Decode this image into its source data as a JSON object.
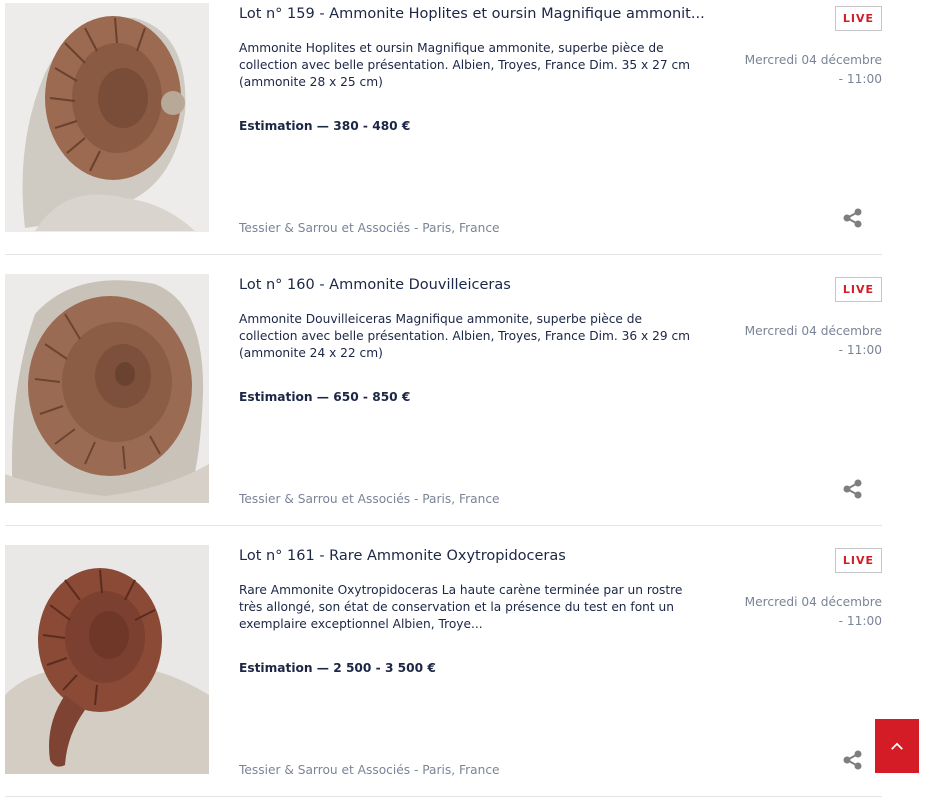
{
  "colors": {
    "accent": "#d41c26",
    "text": "#1c2645",
    "muted": "#7b8497"
  },
  "lots": [
    {
      "title": "Lot n° 159 - Ammonite Hoplites et oursin Magnifique ammonit...",
      "description": "Ammonite Hoplites et oursin Magnifique ammonite, superbe pièce de collection avec belle présentation. Albien, Troyes, France Dim. 35 x 27 cm (ammonite 28 x 25 cm)",
      "estimate": "Estimation — 380 - 480 €",
      "house": "Tessier & Sarrou et Associés - Paris, France",
      "badge": "LIVE",
      "date_line1": "Mercredi 04 décembre",
      "date_line2": "- 11:00",
      "image_icon": "ammonite-photo"
    },
    {
      "title": "Lot n° 160 - Ammonite Douvilleiceras",
      "description": "Ammonite Douvilleiceras Magnifique ammonite, superbe pièce de collection avec belle présentation. Albien, Troyes, France Dim. 36 x 29 cm (ammonite 24 x 22 cm)",
      "estimate": "Estimation — 650 - 850 €",
      "house": "Tessier & Sarrou et Associés - Paris, France",
      "badge": "LIVE",
      "date_line1": "Mercredi 04 décembre",
      "date_line2": "- 11:00",
      "image_icon": "ammonite-photo"
    },
    {
      "title": "Lot n° 161 - Rare Ammonite Oxytropidoceras",
      "description": "Rare Ammonite Oxytropidoceras La haute carène terminée par un rostre très allongé, son état de conservation et la présence du test en font un exemplaire exceptionnel Albien, Troye...",
      "estimate": "Estimation — 2 500 - 3 500 €",
      "house": "Tessier & Sarrou et Associés - Paris, France",
      "badge": "LIVE",
      "date_line1": "Mercredi 04 décembre",
      "date_line2": "- 11:00",
      "image_icon": "ammonite-photo"
    }
  ],
  "icons": {
    "share": "share-icon",
    "back_to_top": "chevron-up-icon"
  }
}
